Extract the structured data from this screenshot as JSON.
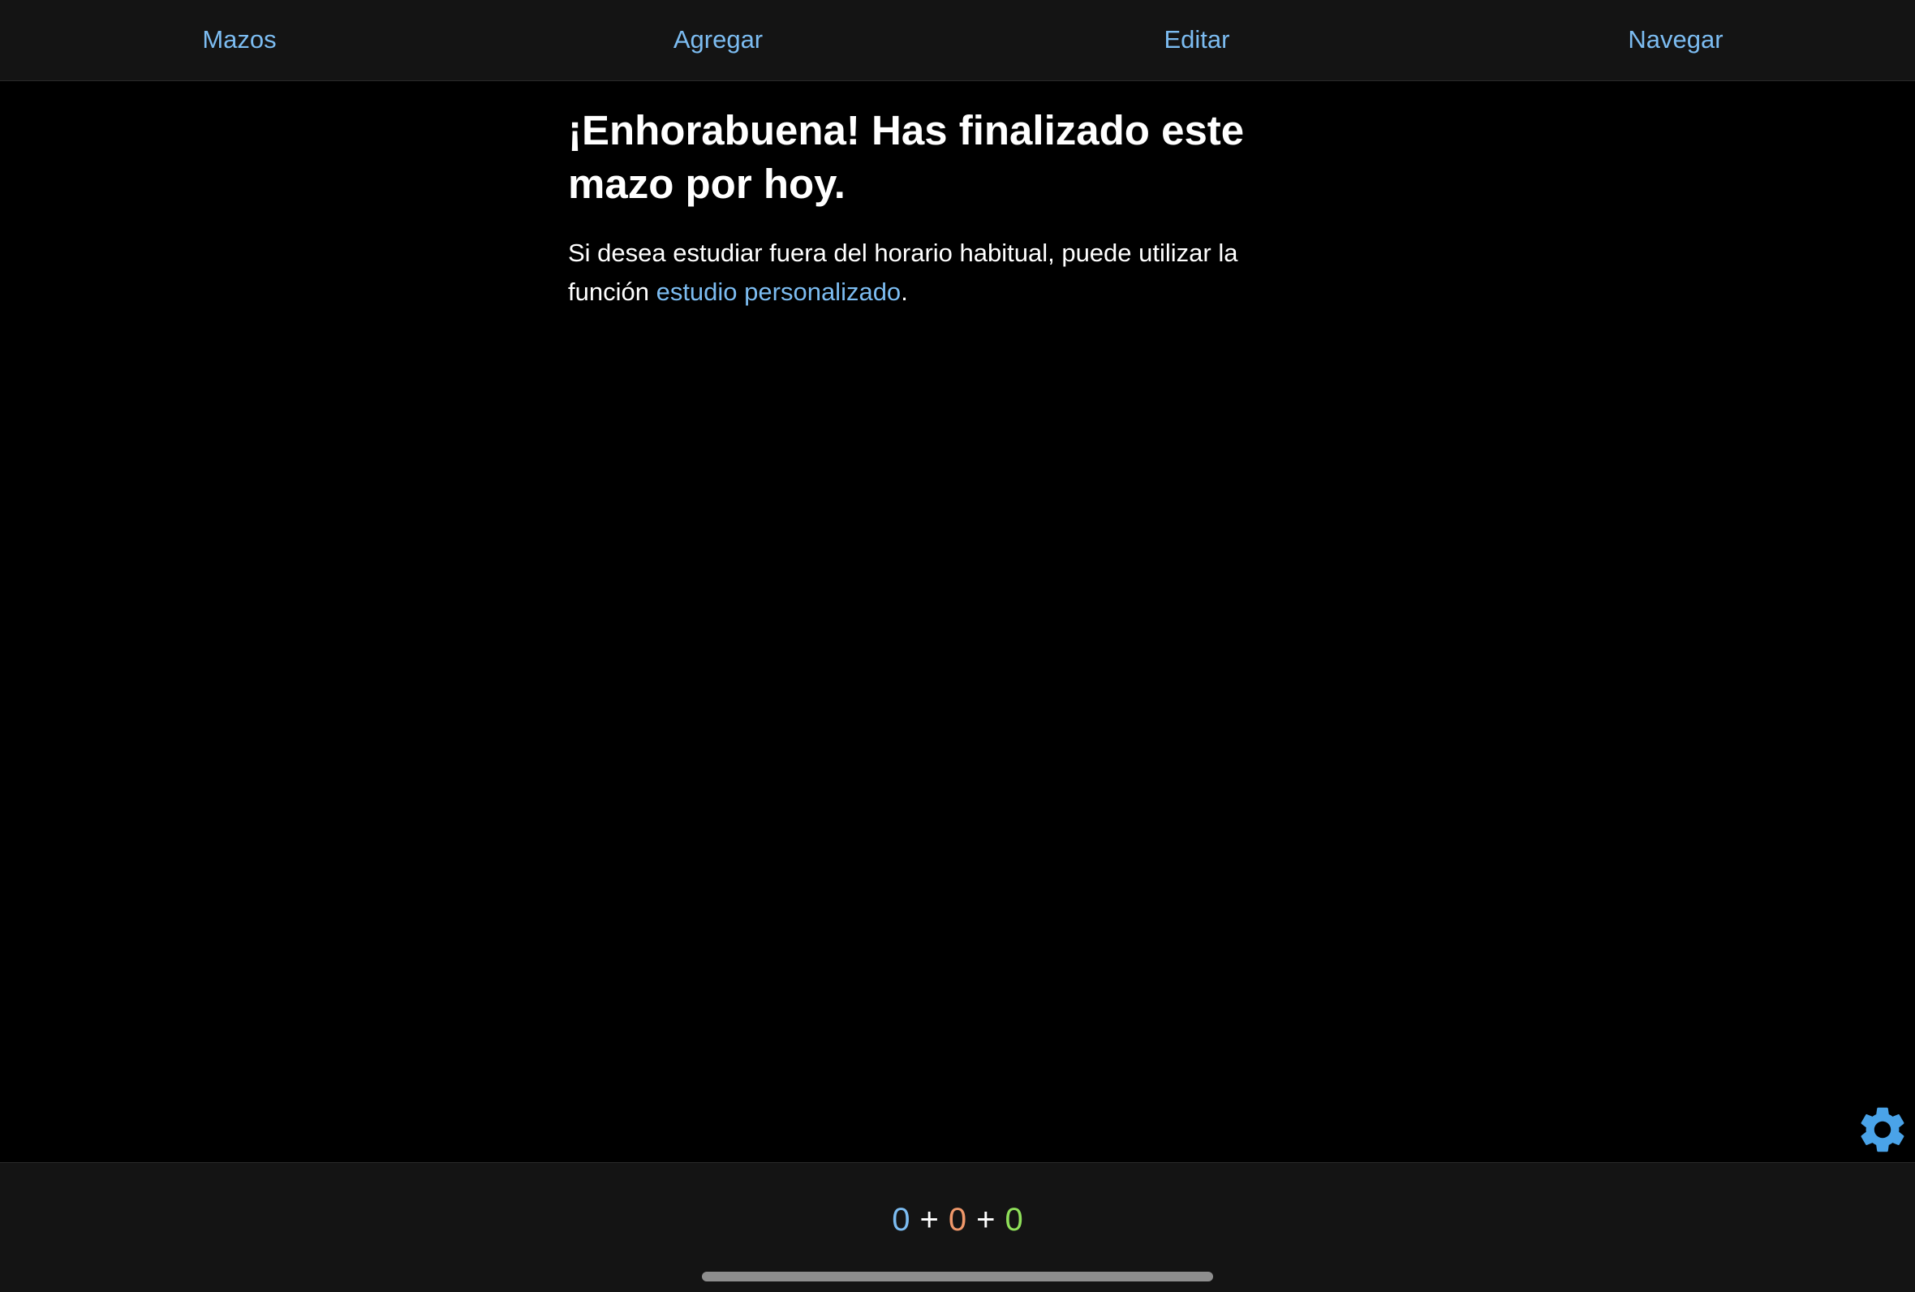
{
  "nav": {
    "items": [
      {
        "label": "Mazos"
      },
      {
        "label": "Agregar"
      },
      {
        "label": "Editar"
      },
      {
        "label": "Navegar"
      }
    ]
  },
  "main": {
    "title": "¡Enhorabuena! Has finalizado este mazo por hoy.",
    "message_prefix": "Si desea estudiar fuera del horario habitual, puede utilizar la función ",
    "link_text": "estudio personalizado",
    "message_suffix": "."
  },
  "settings": {
    "icon": "gear-icon"
  },
  "counts": {
    "new": "0",
    "learning": "0",
    "review": "0",
    "separator": "+"
  },
  "colors": {
    "accent": "#7cbcf1",
    "new": "#7cbcf1",
    "learning": "#f0986a",
    "review": "#8fe05a",
    "bar_background": "#141414",
    "background": "#000000"
  }
}
